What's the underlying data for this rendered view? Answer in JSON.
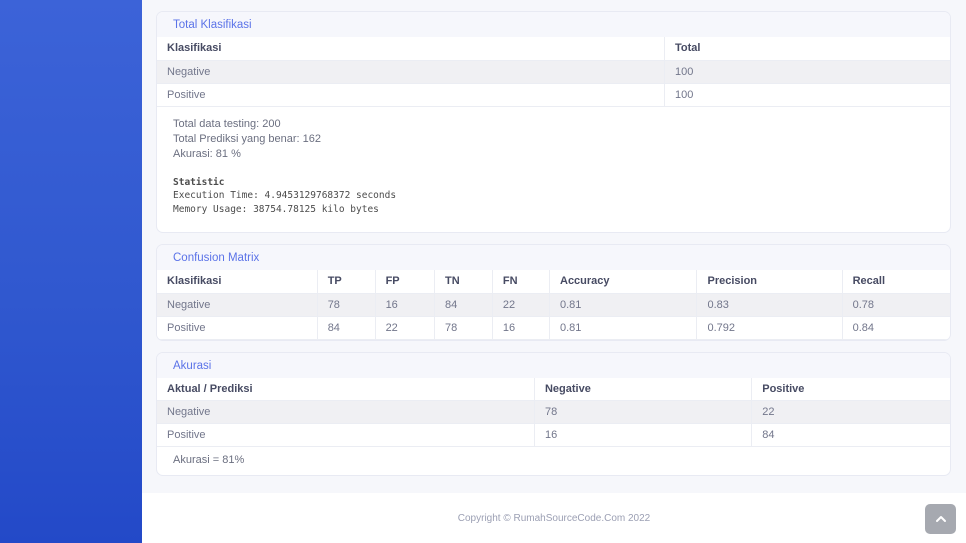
{
  "colors": {
    "sidebar_gradient_top": "#3c63d8",
    "sidebar_gradient_bottom": "#2349c8",
    "content_bg": "#f6f7fb",
    "card_title_blue": "#5b73e8",
    "stripe_row_bg": "#f0f0f3",
    "table_border": "#ebedf3",
    "scroll_button_bg": "#a6a9b0"
  },
  "cards": {
    "total_klasifikasi": {
      "title": "Total Klasifikasi",
      "table": {
        "headers": [
          "Klasifikasi",
          "Total"
        ],
        "rows": [
          [
            "Negative",
            "100"
          ],
          [
            "Positive",
            "100"
          ]
        ]
      },
      "summary": {
        "line1": "Total data testing: 200",
        "line2": "Total Prediksi yang benar: 162",
        "line3": "Akurasi: 81 %"
      },
      "statistic": {
        "title": "Statistic",
        "execution_time": "Execution Time: 4.9453129768372 seconds",
        "memory_usage": "Memory Usage: 38754.78125 kilo bytes"
      }
    },
    "confusion_matrix": {
      "title": "Confusion Matrix",
      "table": {
        "headers": [
          "Klasifikasi",
          "TP",
          "FP",
          "TN",
          "FN",
          "Accuracy",
          "Precision",
          "Recall"
        ],
        "rows": [
          [
            "Negative",
            "78",
            "16",
            "84",
            "22",
            "0.81",
            "0.83",
            "0.78"
          ],
          [
            "Positive",
            "84",
            "22",
            "78",
            "16",
            "0.81",
            "0.792",
            "0.84"
          ]
        ]
      }
    },
    "akurasi": {
      "title": "Akurasi",
      "table": {
        "headers": [
          "Aktual / Prediksi",
          "Negative",
          "Positive"
        ],
        "rows": [
          [
            "Negative",
            "78",
            "22"
          ],
          [
            "Positive",
            "16",
            "84"
          ]
        ]
      },
      "note": "Akurasi = 81%"
    }
  },
  "footer": {
    "copyright": "Copyright © RumahSourceCode.Com 2022"
  },
  "scroll_top": {
    "icon": "chevron-up"
  }
}
